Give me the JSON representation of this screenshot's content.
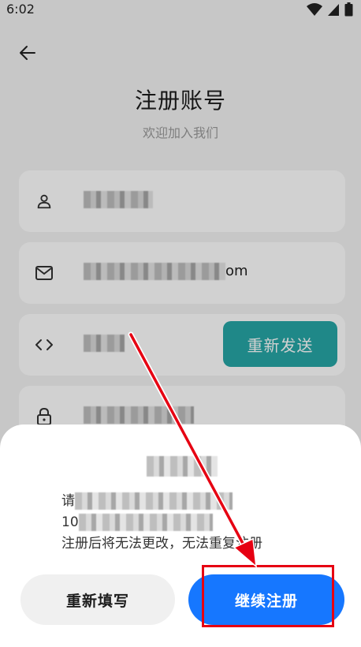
{
  "status_bar": {
    "time": "6:02"
  },
  "header": {
    "title": "注册账号",
    "subtitle": "欢迎加入我们"
  },
  "form": {
    "email_suffix": "om",
    "resend_label": "重新发送"
  },
  "dialog": {
    "msg_prefix": "请",
    "msg_line2_prefix": "10",
    "warning": "注册后将无法更改，无法重复注册",
    "refill_label": "重新填写",
    "continue_label": "继续注册"
  },
  "colors": {
    "accent_blue": "#1677ff",
    "resend_teal": "#27a6a6",
    "annotation_red": "#e60012"
  }
}
